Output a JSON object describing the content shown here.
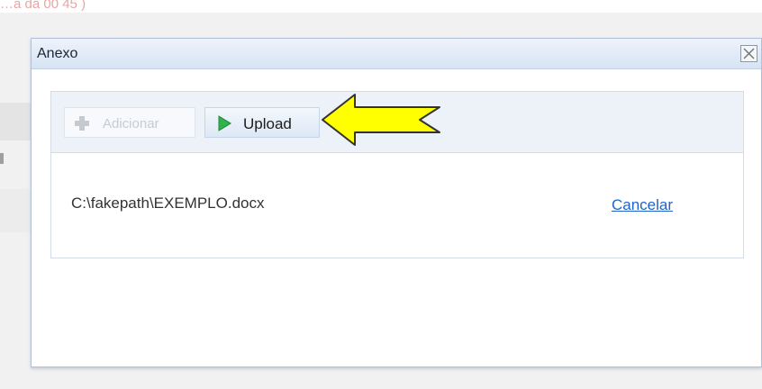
{
  "background": {
    "top_text": "…a da 00 45 )"
  },
  "dialog": {
    "title": "Anexo",
    "close_label": "close"
  },
  "toolbar": {
    "add_label": "Adicionar",
    "upload_label": "Upload"
  },
  "upload_item": {
    "file_path": "C:\\fakepath\\EXEMPLO.docx",
    "cancel_label": "Cancelar"
  },
  "colors": {
    "title_bar": "#d7e3f3",
    "link": "#1e63c8",
    "annotation_arrow_fill": "#ffff00",
    "annotation_arrow_stroke": "#333333",
    "play_icon": "#2fb34a"
  },
  "icons": {
    "add": "plus-icon",
    "upload": "play-arrow-icon",
    "close": "close-icon",
    "annotation": "yellow-arrow-icon"
  }
}
